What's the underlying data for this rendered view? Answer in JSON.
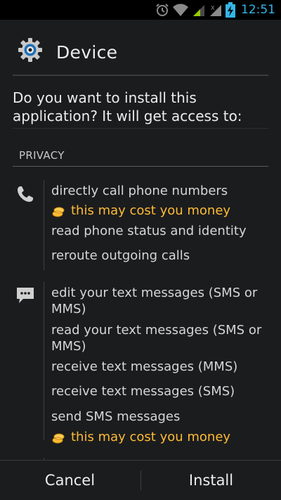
{
  "status_bar": {
    "time": "12:51",
    "icons": [
      "alarm-icon",
      "wifi-icon",
      "signal-icon",
      "signal-icon",
      "battery-charging-icon"
    ],
    "accent_color": "#33b5e5"
  },
  "header": {
    "title": "Device",
    "icon": "settings-gear-icon"
  },
  "prompt": {
    "text": "Do you want to install this application? It will get access to:"
  },
  "section": {
    "title": "PRIVACY"
  },
  "groups": [
    {
      "icon": "phone-icon",
      "items": [
        {
          "text": "directly call phone numbers"
        },
        {
          "text": "this may cost you money",
          "warning": true
        },
        {
          "text": "read phone status and identity"
        },
        {
          "text": "reroute outgoing calls"
        }
      ]
    },
    {
      "icon": "message-icon",
      "items": [
        {
          "text": "edit your text messages (SMS or MMS)"
        },
        {
          "text": "read your text messages (SMS or MMS)"
        },
        {
          "text": "receive text messages (MMS)"
        },
        {
          "text": "receive text messages (SMS)"
        },
        {
          "text": "send SMS messages"
        },
        {
          "text": "this may cost you money",
          "warning": true
        }
      ]
    }
  ],
  "colors": {
    "warning": "#ffbb33",
    "background": "#1b1c1e"
  },
  "buttons": {
    "cancel": "Cancel",
    "install": "Install"
  }
}
